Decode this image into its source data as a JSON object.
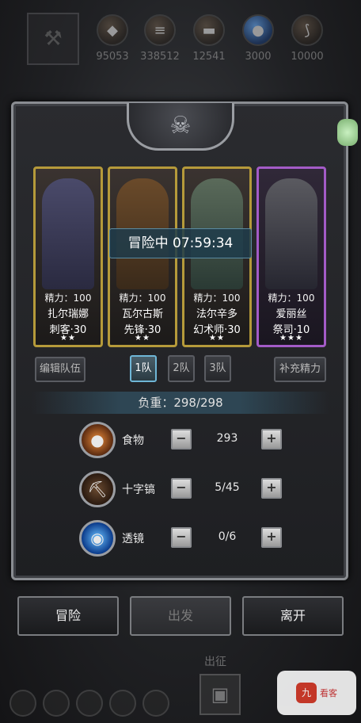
{
  "resources": [
    {
      "icon": "ore-icon",
      "value": "95053"
    },
    {
      "icon": "wood-icon",
      "value": "338512"
    },
    {
      "icon": "iron-icon",
      "value": "12541"
    },
    {
      "icon": "crystal-icon",
      "value": "3000"
    },
    {
      "icon": "claw-icon",
      "value": "10000"
    }
  ],
  "heroes": [
    {
      "stamina": "精力：100",
      "name": "扎尔瑞娜",
      "class": "刺客·30",
      "stars": "★★",
      "frame": "gold"
    },
    {
      "stamina": "精力：100",
      "name": "瓦尔古斯",
      "class": "先锋·30",
      "stars": "★★",
      "frame": "gold"
    },
    {
      "stamina": "精力：100",
      "name": "法尔辛多",
      "class": "幻术师·30",
      "stars": "★★",
      "frame": "gold"
    },
    {
      "stamina": "精力：100",
      "name": "爱丽丝",
      "class": "祭司·10",
      "stars": "★★★",
      "frame": "purple"
    }
  ],
  "timer": "冒险中 07:59:34",
  "buttons": {
    "edit_team": "编辑队伍",
    "team1": "1队",
    "team2": "2队",
    "team3": "3队",
    "refill": "补充精力"
  },
  "weight": "负重：298/298",
  "supplies": [
    {
      "label": "食物",
      "count": "293",
      "icon": "food-icon"
    },
    {
      "label": "十字镐",
      "count": "5/45",
      "icon": "pickaxe-icon"
    },
    {
      "label": "透镜",
      "count": "0/6",
      "icon": "lens-icon"
    }
  ],
  "bottom": {
    "adventure": "冒险",
    "depart": "出发",
    "leave": "离开"
  },
  "footer": {
    "label": "出征"
  },
  "watermark": {
    "text": "看客"
  }
}
